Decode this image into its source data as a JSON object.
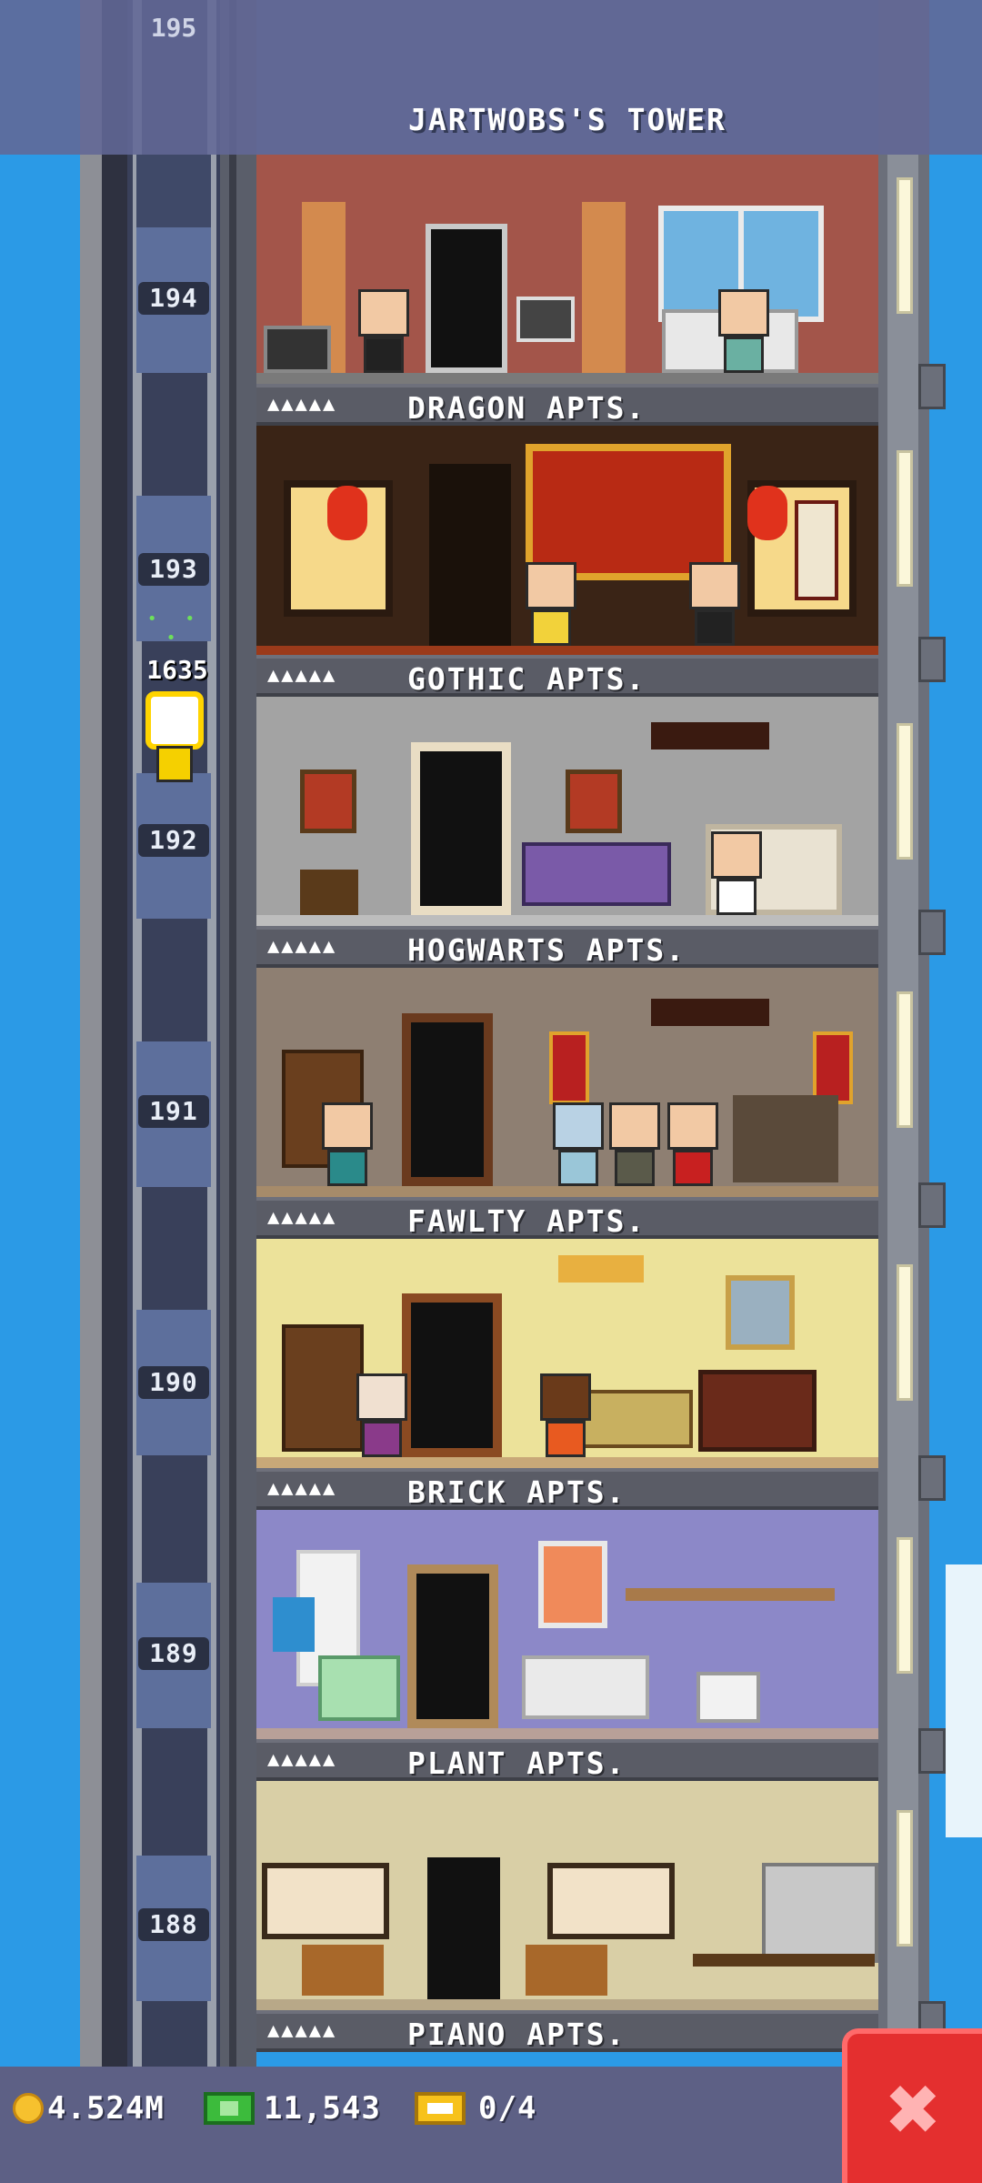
{
  "tower": {
    "title": "JARTWOBS'S TOWER",
    "top_floor_number": "195"
  },
  "floors": [
    {
      "number": "194",
      "sign": "DRAGON APTS.",
      "stars": "▲▲▲▲▲"
    },
    {
      "number": "193",
      "sign": "GOTHIC APTS.",
      "stars": "▲▲▲▲▲"
    },
    {
      "number": "192",
      "sign": "HOGWARTS APTS.",
      "stars": "▲▲▲▲▲"
    },
    {
      "number": "191",
      "sign": "FAWLTY APTS.",
      "stars": "▲▲▲▲▲"
    },
    {
      "number": "190",
      "sign": "BRICK APTS.",
      "stars": "▲▲▲▲▲"
    },
    {
      "number": "189",
      "sign": "PLANT APTS.",
      "stars": "▲▲▲▲▲"
    },
    {
      "number": "188",
      "sign": "PIANO APTS.",
      "stars": "▲▲▲▲▲"
    }
  ],
  "elevator": {
    "counter": "1635",
    "dots": "• • •"
  },
  "hud": {
    "coins": "4.524M",
    "cash": "11,543",
    "bux_progress": "0/4",
    "coin_icon": "coin-icon",
    "cash_icon": "cash-icon",
    "bux_icon": "golden-ticket-icon",
    "close_icon": "close-icon"
  },
  "colors": {
    "sky": "#2b9ae6",
    "hud_bg": "#5d6085",
    "close_button": "#e42f2f",
    "sign_bg": "#5a5c66"
  }
}
